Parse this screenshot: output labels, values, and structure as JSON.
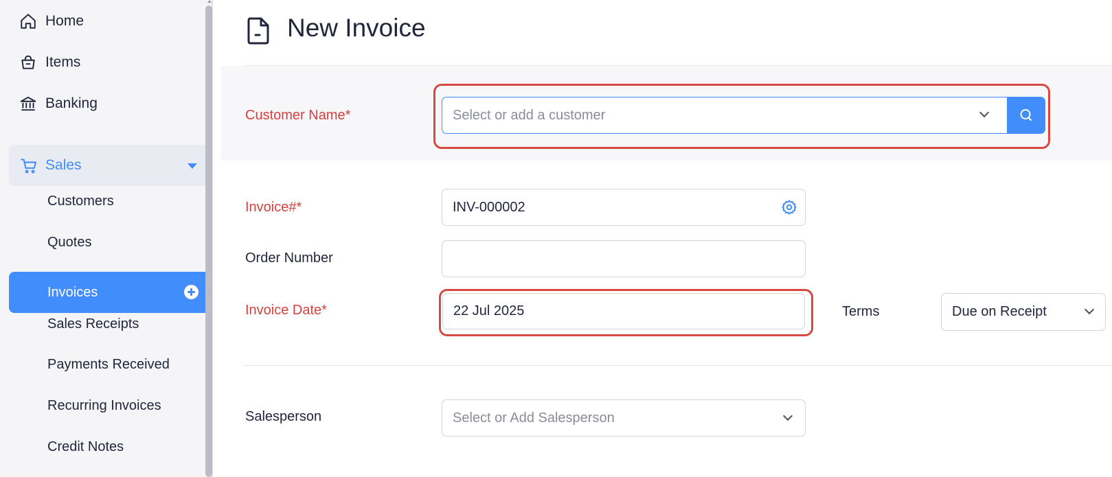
{
  "sidebar": {
    "top_items": [
      {
        "label": "Home",
        "icon": "home-icon"
      },
      {
        "label": "Items",
        "icon": "basket-icon"
      },
      {
        "label": "Banking",
        "icon": "bank-icon"
      }
    ],
    "group": {
      "label": "Sales",
      "icon": "cart-icon",
      "expanded": true
    },
    "sub_items": [
      {
        "label": "Customers"
      },
      {
        "label": "Quotes"
      },
      {
        "label": "Invoices",
        "active": true
      },
      {
        "label": "Sales Receipts"
      },
      {
        "label": "Payments Received"
      },
      {
        "label": "Recurring Invoices"
      },
      {
        "label": "Credit Notes"
      }
    ]
  },
  "header": {
    "title": "New Invoice",
    "icon": "document-icon"
  },
  "form": {
    "customer_name": {
      "label": "Customer Name*",
      "placeholder": "Select or add a customer",
      "value": ""
    },
    "invoice_number": {
      "label": "Invoice#*",
      "value": "INV-000002"
    },
    "order_number": {
      "label": "Order Number",
      "value": ""
    },
    "invoice_date": {
      "label": "Invoice Date*",
      "value": "22 Jul 2025"
    },
    "terms": {
      "label": "Terms",
      "value": "Due on Receipt"
    },
    "salesperson": {
      "label": "Salesperson",
      "placeholder": "Select or Add Salesperson",
      "value": ""
    }
  },
  "colors": {
    "accent": "#408dfb",
    "required": "#d6403d",
    "highlight": "#d7483f"
  }
}
